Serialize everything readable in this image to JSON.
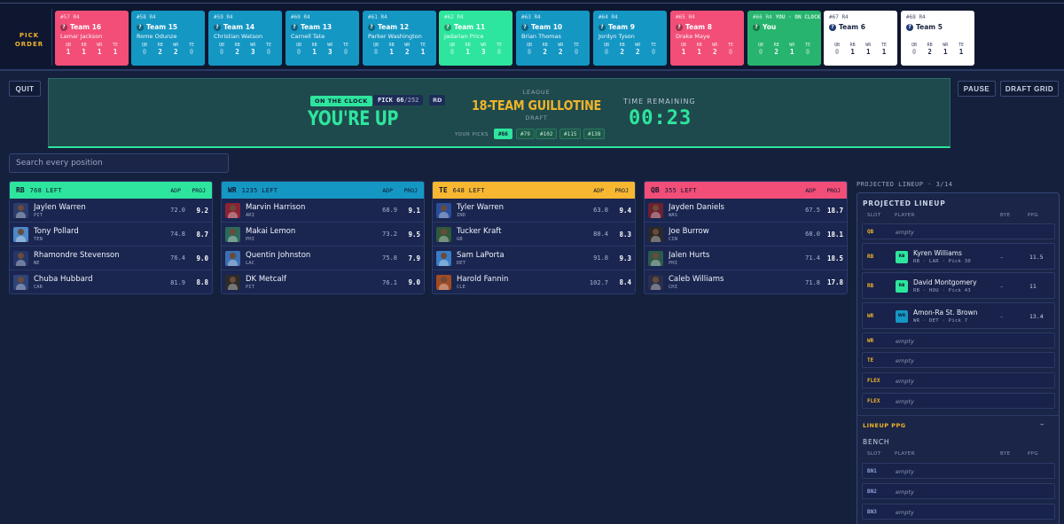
{
  "pick_order": {
    "label_line1": "PICK",
    "label_line2": "ORDER",
    "cards": [
      {
        "pick": "#57 R4",
        "team": "Team 16",
        "player": "Lamar Jackson",
        "qb": "1",
        "rb": "1",
        "wr": "1",
        "te": "1",
        "color": "#f24e78"
      },
      {
        "pick": "#58 R4",
        "team": "Team 15",
        "player": "Rome Odunze",
        "qb": "0",
        "rb": "2",
        "wr": "2",
        "te": "0",
        "color": "#1597c4"
      },
      {
        "pick": "#59 R4",
        "team": "Team 14",
        "player": "Christian Watson",
        "qb": "0",
        "rb": "2",
        "wr": "3",
        "te": "0",
        "color": "#1597c4"
      },
      {
        "pick": "#60 R4",
        "team": "Team 13",
        "player": "Carnell Tate",
        "qb": "0",
        "rb": "1",
        "wr": "3",
        "te": "0",
        "color": "#1597c4"
      },
      {
        "pick": "#61 R4",
        "team": "Team 12",
        "player": "Parker Washington",
        "qb": "0",
        "rb": "1",
        "wr": "2",
        "te": "1",
        "color": "#1597c4"
      },
      {
        "pick": "#62 R4",
        "team": "Team 11",
        "player": "Jadarian Price",
        "qb": "0",
        "rb": "1",
        "wr": "3",
        "te": "0",
        "color": "#2ee59d"
      },
      {
        "pick": "#63 R4",
        "team": "Team 10",
        "player": "Brian Thomas",
        "qb": "0",
        "rb": "2",
        "wr": "2",
        "te": "0",
        "color": "#1597c4"
      },
      {
        "pick": "#64 R4",
        "team": "Team 9",
        "player": "Jordyn Tyson",
        "qb": "0",
        "rb": "2",
        "wr": "2",
        "te": "0",
        "color": "#1597c4"
      },
      {
        "pick": "#65 R4",
        "team": "Team 8",
        "player": "Drake Maye",
        "qb": "1",
        "rb": "1",
        "wr": "2",
        "te": "0",
        "color": "#f24e78"
      },
      {
        "pick": "#66 R4",
        "tag": "YOU · ON CLOCK",
        "team": "You",
        "player": "",
        "qb": "0",
        "rb": "2",
        "wr": "1",
        "te": "0",
        "color": "#27b46e"
      },
      {
        "pick": "#67 R4",
        "team": "Team 6",
        "player": "",
        "qb": "0",
        "rb": "1",
        "wr": "1",
        "te": "1",
        "color": "#ffffff"
      },
      {
        "pick": "#68 R4",
        "team": "Team 5",
        "player": "",
        "qb": "0",
        "rb": "2",
        "wr": "1",
        "te": "1",
        "color": "#ffffff"
      }
    ]
  },
  "buttons": {
    "quit": "QUIT",
    "pause": "PAUSE",
    "draft_grid": "DRAFT GRID"
  },
  "banner": {
    "on_clock": "ON THE CLOCK",
    "pick_label": "PICK 66",
    "pick_total": "/252",
    "round_tag": "RD",
    "headline": "YOU'RE UP",
    "league_label": "LEAGUE",
    "league_name": "18-TEAM GUILLOTINE",
    "draft_label": "DRAFT",
    "your_picks_label": "YOUR PICKS",
    "your_picks": [
      "#66",
      "#79",
      "#102",
      "#115",
      "#138"
    ],
    "time_label": "TIME REMAINING",
    "timer": "00:23"
  },
  "search": {
    "placeholder": "Search every position"
  },
  "columns": {
    "adp": "ADP",
    "proj": "PROJ"
  },
  "panels": [
    {
      "pos": "RB",
      "left": "768 LEFT",
      "color": "#2ee59d",
      "players": [
        {
          "name": "Jaylen Warren",
          "team": "PIT",
          "adp": "72.0",
          "proj": "9.2",
          "bg": "#2b3d6b"
        },
        {
          "name": "Tony Pollard",
          "team": "TEN",
          "adp": "74.8",
          "proj": "8.7",
          "bg": "#4d88c8"
        },
        {
          "name": "Rhamondre Stevenson",
          "team": "NE",
          "adp": "76.4",
          "proj": "9.0",
          "bg": "#25366a"
        },
        {
          "name": "Chuba Hubbard",
          "team": "CAR",
          "adp": "81.9",
          "proj": "8.8",
          "bg": "#2d4478"
        }
      ]
    },
    {
      "pos": "WR",
      "left": "1235 LEFT",
      "color": "#1597c4",
      "players": [
        {
          "name": "Marvin Harrison",
          "team": "ARI",
          "adp": "68.9",
          "proj": "9.1",
          "bg": "#8b2335"
        },
        {
          "name": "Makai Lemon",
          "team": "PHI",
          "adp": "73.2",
          "proj": "9.5",
          "bg": "#2d6a5a"
        },
        {
          "name": "Quentin Johnston",
          "team": "LAC",
          "adp": "75.8",
          "proj": "7.9",
          "bg": "#3b6fb0"
        },
        {
          "name": "DK Metcalf",
          "team": "PIT",
          "adp": "76.1",
          "proj": "9.0",
          "bg": "#2b2b2b"
        }
      ]
    },
    {
      "pos": "TE",
      "left": "648 LEFT",
      "color": "#f7b731",
      "players": [
        {
          "name": "Tyler Warren",
          "team": "IND",
          "adp": "63.8",
          "proj": "9.4",
          "bg": "#2a4f9a"
        },
        {
          "name": "Tucker Kraft",
          "team": "GB",
          "adp": "80.4",
          "proj": "8.3",
          "bg": "#2f5a3a"
        },
        {
          "name": "Sam LaPorta",
          "team": "DET",
          "adp": "91.8",
          "proj": "9.3",
          "bg": "#3a7dc4"
        },
        {
          "name": "Harold Fannin",
          "team": "CLE",
          "adp": "102.7",
          "proj": "8.4",
          "bg": "#a34a22"
        }
      ]
    },
    {
      "pos": "QB",
      "left": "355 LEFT",
      "color": "#f24e78",
      "players": [
        {
          "name": "Jayden Daniels",
          "team": "WAS",
          "adp": "67.5",
          "proj": "18.7",
          "bg": "#6d2030"
        },
        {
          "name": "Joe Burrow",
          "team": "CIN",
          "adp": "68.0",
          "proj": "18.1",
          "bg": "#2a2a2a"
        },
        {
          "name": "Jalen Hurts",
          "team": "PHI",
          "adp": "71.4",
          "proj": "18.5",
          "bg": "#2d5a4a"
        },
        {
          "name": "Caleb Williams",
          "team": "CHI",
          "adp": "71.8",
          "proj": "17.8",
          "bg": "#2a2f4a"
        }
      ]
    }
  ],
  "lineup": {
    "title": "PROJECTED LINEUP · 3/14",
    "header": "PROJECTED LINEUP",
    "cols": {
      "slot": "SLOT",
      "player": "PLAYER",
      "bye": "BYE",
      "ppg": "PPG"
    },
    "starters": [
      {
        "slot": "QB",
        "empty": "empty"
      },
      {
        "slot": "RB",
        "player": "Kyren Williams",
        "sub": "RB · LAR · Pick 30",
        "chip": "RB",
        "bye": "–",
        "ppg": "11.5",
        "chip_color": "#2ee59d"
      },
      {
        "slot": "RB",
        "player": "David Montgomery",
        "sub": "RB · HOU · Pick 43",
        "chip": "RB",
        "bye": "–",
        "ppg": "11",
        "chip_color": "#2ee59d"
      },
      {
        "slot": "WR",
        "player": "Amon-Ra St. Brown",
        "sub": "WR · DET · Pick 7",
        "chip": "WR",
        "bye": "–",
        "ppg": "13.4",
        "chip_color": "#1597c4"
      },
      {
        "slot": "WR",
        "empty": "empty"
      },
      {
        "slot": "TE",
        "empty": "empty"
      },
      {
        "slot": "FLEX",
        "empty": "empty"
      },
      {
        "slot": "FLEX",
        "empty": "empty"
      }
    ],
    "ppg_label": "LINEUP PPG",
    "ppg_value": "–",
    "bench_header": "BENCH",
    "bench": [
      {
        "slot": "BN1",
        "empty": "empty"
      },
      {
        "slot": "BN2",
        "empty": "empty"
      },
      {
        "slot": "BN3",
        "empty": "empty"
      }
    ]
  }
}
